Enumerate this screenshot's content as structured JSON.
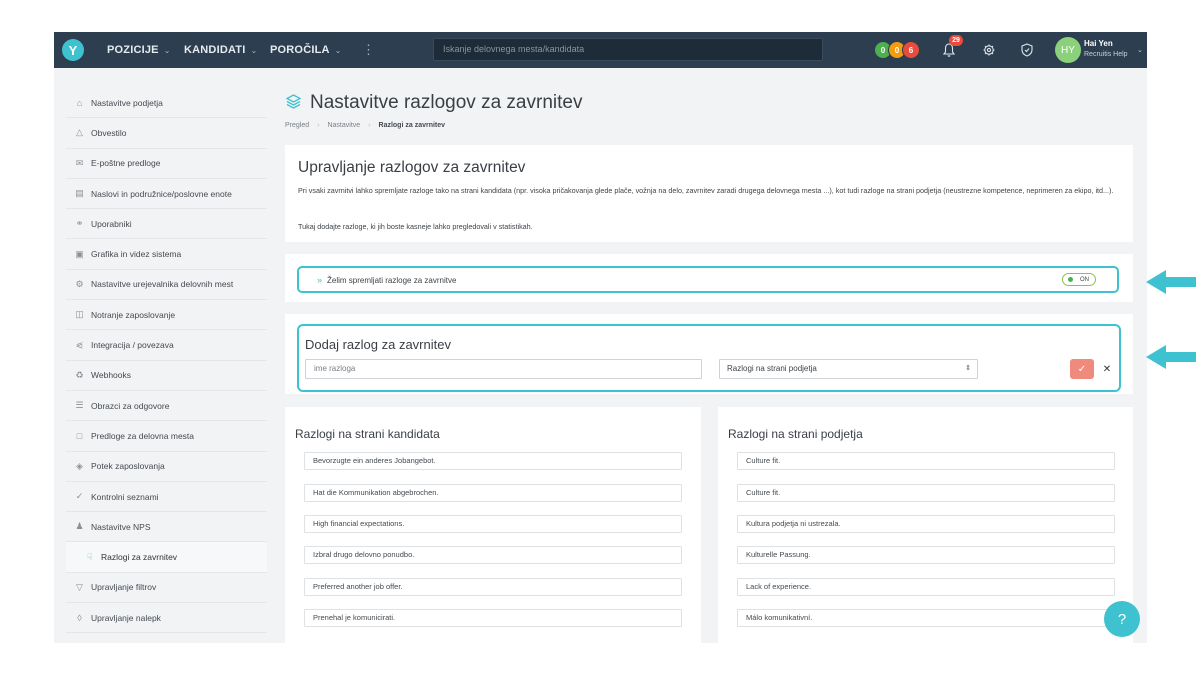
{
  "topbar": {
    "nav": [
      {
        "label": "POZICIJE"
      },
      {
        "label": "KANDIDATI"
      },
      {
        "label": "POROČILA"
      }
    ],
    "search_placeholder": "Iskanje delovnega mesta/kandidata",
    "counters": [
      "0",
      "0",
      "6"
    ],
    "notifications_count": "29",
    "user": {
      "initials": "HY",
      "name": "Hai Yen",
      "org": "Recruitis Help"
    }
  },
  "sidebar": {
    "items": [
      {
        "label": "Nastavitve podjetja",
        "icon": "home-icon"
      },
      {
        "label": "Obvestilo",
        "icon": "bell-icon"
      },
      {
        "label": "E-poštne predloge",
        "icon": "envelope-icon"
      },
      {
        "label": "Naslovi in podružnice/poslovne enote",
        "icon": "building-icon"
      },
      {
        "label": "Uporabniki",
        "icon": "users-icon"
      },
      {
        "label": "Grafika in videz sistema",
        "icon": "image-icon"
      },
      {
        "label": "Nastavitve urejevalnika delovnih mest",
        "icon": "gears-icon"
      },
      {
        "label": "Notranje zaposlovanje",
        "icon": "id-card-icon"
      },
      {
        "label": "Integracija / povezava",
        "icon": "share-icon"
      },
      {
        "label": "Webhooks",
        "icon": "webhook-icon"
      },
      {
        "label": "Obrazci za odgovore",
        "icon": "list-icon"
      },
      {
        "label": "Predloge za delovna mesta",
        "icon": "document-icon"
      },
      {
        "label": "Potek zaposlovanja",
        "icon": "layers-icon"
      },
      {
        "label": "Kontrolni seznami",
        "icon": "check-circle-icon"
      },
      {
        "label": "Nastavitve NPS",
        "icon": "person-icon"
      },
      {
        "label": "Razlogi za zavrnitev",
        "icon": "thumbs-down-icon",
        "active": true
      },
      {
        "label": "Upravljanje filtrov",
        "icon": "filter-icon"
      },
      {
        "label": "Upravljanje nalepk",
        "icon": "tag-icon"
      }
    ]
  },
  "page": {
    "title": "Nastavitve razlogov za zavrnitev",
    "breadcrumb": [
      "Pregled",
      "Nastavitve",
      "Razlogi za zavrnitev"
    ]
  },
  "intro": {
    "title": "Upravljanje razlogov za zavrnitev",
    "text1": "Pri vsaki zavrnitvi lahko spremljate razloge tako na strani kandidata (npr. visoka pričakovanja glede plače, vožnja na delo, zavrnitev zaradi drugega delovnega mesta ...), kot tudi razloge na strani podjetja (neustrezne kompetence, neprimeren za ekipo, itd...).",
    "text2": "Tukaj dodajte razloge, ki jih boste kasneje lahko pregledovali v statistikah."
  },
  "toggle": {
    "label": "Želim spremljati razloge za zavrnitve",
    "state": "ON"
  },
  "add_reason": {
    "title": "Dodaj razlog za zavrnitev",
    "input_placeholder": "ime razloga",
    "select_value": "Razlogi na strani podjetja"
  },
  "candidate_reasons": {
    "title": "Razlogi na strani kandidata",
    "items": [
      "Bevorzugte ein anderes Jobangebot.",
      "Hat die Kommunikation abgebrochen.",
      "High financial expectations.",
      "Izbral drugo delovno ponudbo.",
      "Preferred another job offer.",
      "Prenehal je komunicirati."
    ]
  },
  "company_reasons": {
    "title": "Razlogi na strani podjetja",
    "items": [
      "Culture fit.",
      "Culture fit.",
      "Kultura podjetja ni ustrezala.",
      "Kulturelle Passung.",
      "Lack of experience.",
      "Málo komunikativní."
    ]
  },
  "help_label": "?",
  "colors": {
    "accent": "#3fc2d0",
    "topbar": "#2c3e50",
    "confirm": "#f08a7c"
  }
}
